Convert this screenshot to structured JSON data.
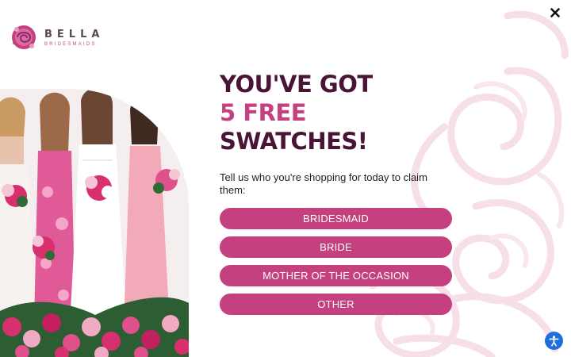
{
  "brand": {
    "name": "BELLA",
    "tagline": "BRIDESMAIDS"
  },
  "close_icon": "close-icon",
  "offer": {
    "headline_line1": "YOU'VE GOT",
    "headline_accent": "5 FREE",
    "headline_rest": "SWATCHES!",
    "prompt": "Tell us who you're shopping for today to claim them:"
  },
  "choices": [
    {
      "label": "BRIDESMAID"
    },
    {
      "label": "BRIDE"
    },
    {
      "label": "MOTHER OF THE OCCASION"
    },
    {
      "label": "OTHER"
    }
  ],
  "colors": {
    "accent": "#c5407f",
    "headline": "#4a1437",
    "accessibility": "#1e6fd9"
  },
  "accessibility_icon": "accessibility-icon"
}
